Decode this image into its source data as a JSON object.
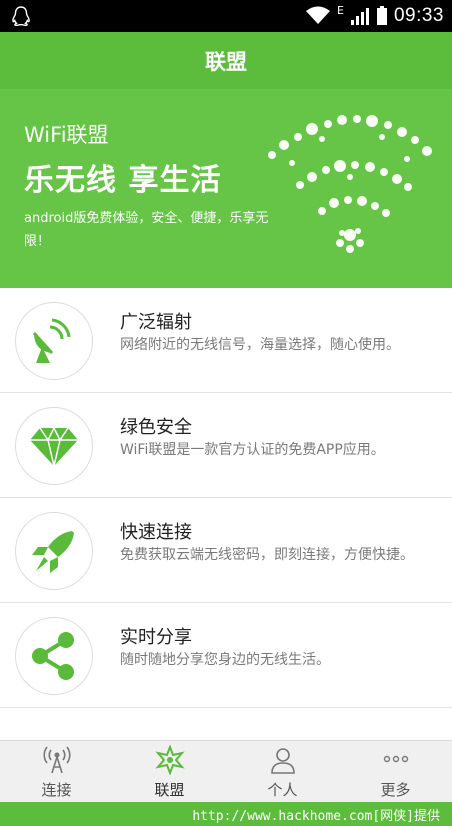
{
  "status_bar": {
    "network": "E",
    "time": "09:33"
  },
  "app_title": "联盟",
  "banner": {
    "title": "WiFi联盟",
    "slogan": "乐无线 享生活",
    "description": "android版免费体验，安全、便捷，乐享无限！"
  },
  "features": [
    {
      "title": "广泛辐射",
      "description": "网络附近的无线信号，海量选择，随心使用。",
      "icon": "satellite-dish-icon"
    },
    {
      "title": "绿色安全",
      "description": "WiFi联盟是一款官方认证的免费APP应用。",
      "icon": "diamond-icon"
    },
    {
      "title": "快速连接",
      "description": "免费获取云端无线密码，即刻连接，方便快捷。",
      "icon": "rocket-icon"
    },
    {
      "title": "实时分享",
      "description": "随时随地分享您身边的无线生活。",
      "icon": "share-icon"
    }
  ],
  "tabs": [
    {
      "label": "连接",
      "icon": "wifi-tower-icon",
      "active": false
    },
    {
      "label": "联盟",
      "icon": "alliance-star-icon",
      "active": true
    },
    {
      "label": "个人",
      "icon": "person-icon",
      "active": false
    },
    {
      "label": "更多",
      "icon": "more-dots-icon",
      "active": false
    }
  ],
  "footer_watermark": "http://www.hackhome.com[网侠]提供",
  "colors": {
    "brand_green": "#5cbc3c",
    "banner_green": "#66c447",
    "icon_green": "#5aba3a"
  }
}
